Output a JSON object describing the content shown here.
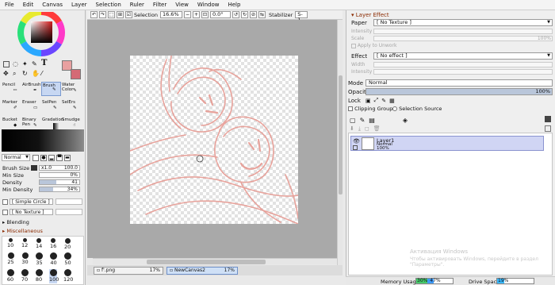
{
  "menu": [
    "File",
    "Edit",
    "Canvas",
    "Layer",
    "Selection",
    "Ruler",
    "Filter",
    "View",
    "Window",
    "Help"
  ],
  "tools": {
    "row1": [
      "Pencil",
      "AirBrush",
      "Brush",
      "Water Color"
    ],
    "row2": [
      "Marker",
      "Eraser",
      "SelPen",
      "SelErs"
    ],
    "row3": [
      "Bucket",
      "Binary Pen",
      "Gradation",
      "Smudge"
    ],
    "selected": "Brush"
  },
  "brush": {
    "blend_mode": "Normal",
    "size_label": "Brush Size",
    "size_multiplier": "x1.0",
    "size_value": "100.0",
    "min_size_label": "Min Size",
    "min_size_value": "0%",
    "density_label": "Density",
    "density_value": "41",
    "density_fraction": 0.41,
    "min_density_label": "Min Density",
    "min_density_value": "34%",
    "min_density_fraction": 0.34,
    "shape": "[ Simple Circle ]",
    "texture": "[ No Texture ]",
    "blending_label": "Blending",
    "misc_label": "Miscellaneous",
    "sizes_row1": [
      "10",
      "12",
      "14",
      "16",
      "20"
    ],
    "sizes_row2": [
      "25",
      "30",
      "35",
      "40",
      "50"
    ],
    "sizes_row3": [
      "60",
      "70",
      "80",
      "100",
      "120"
    ]
  },
  "toolbar": {
    "selection_label": "Selection",
    "zoom": "16.6%",
    "rotation": "0.0°",
    "stabilizer_label": "Stabilizer",
    "stabilizer_value": "S-1"
  },
  "tabs": [
    {
      "name": "f'.png",
      "zoom": "17%"
    },
    {
      "name": "NewCanvas2",
      "zoom": "17%"
    }
  ],
  "right": {
    "layer_effect_title": "Layer Effect",
    "paper_label": "Paper",
    "paper_value": "[ No Texture ]",
    "intensity_label": "Intensity",
    "scale_label": "Scale",
    "scale_value": "100%",
    "apply_undo_label": "Apply to Unwork",
    "effect_label": "Effect",
    "effect_value": "[ No effect ]",
    "width_label": "Width",
    "intensity2_label": "Intensity",
    "mode_label": "Mode",
    "mode_value": "Normal",
    "opacity_label": "Opacity",
    "opacity_value": "100%",
    "lock_label": "Lock",
    "clipping_label": "Clipping Group",
    "selection_source_label": "Selection Source",
    "layer": {
      "name": "Layer1",
      "mode": "Normal",
      "opacity": "100%"
    },
    "watermark_line1": "Активация Windows",
    "watermark_line2": "Чтобы активировать Windows, перейдите в раздел \"Параметры\"."
  },
  "status": {
    "memory_label": "Memory Usage",
    "memory_used": "30%",
    "memory_total": "47%",
    "memory_used_fraction": 0.3,
    "memory_total_fraction": 0.47,
    "drive_label": "Drive Space",
    "drive_value": "19%",
    "drive_fraction": 0.19
  },
  "colors": {
    "primary": "#e8a0a0",
    "secondary": "#d46a75",
    "stroke": "#e79b93",
    "selection_blue": "#c7d7f2"
  }
}
